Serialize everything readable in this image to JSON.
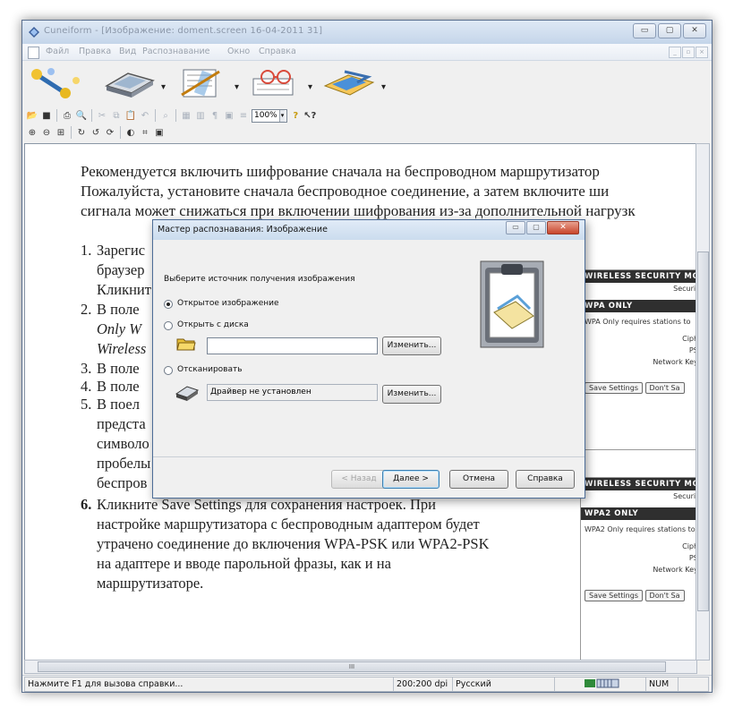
{
  "window": {
    "title": "Cuneiform - [Изображение: doment.screen 16-04-2011 31]",
    "controls": {
      "minimize": "▭",
      "maximize": "▢",
      "close": "✕"
    }
  },
  "menu": {
    "items": [
      "Файл",
      "Правка",
      "Вид",
      "Распознавание",
      "Окно",
      "Справка"
    ],
    "mdi_controls": {
      "minimize": "_",
      "restore": "▫",
      "close": "×"
    }
  },
  "toolbar": {
    "zoom_value": "100%",
    "dropdown_arrow": "▾"
  },
  "document": {
    "paragraph": [
      "Рекомендуется включить шифрование сначала на беспроводном маршрутизатор",
      "Пожалуйста, установите сначала беспроводное соединение, а затем включите ши",
      "сигнала может снижаться при включении шифрования из-за дополнительной нагрузк"
    ],
    "list": [
      {
        "num": "1.",
        "lines": [
          "Зарегис",
          "браузер",
          "Кликнит"
        ]
      },
      {
        "num": "2.",
        "lines": [
          "В поле",
          "Only  W",
          "Wireless"
        ]
      },
      {
        "num": "3.",
        "lines": [
          "В поле"
        ]
      },
      {
        "num": "4.",
        "lines": [
          "В поле"
        ]
      },
      {
        "num": "5.",
        "lines": [
          "В поел",
          "предста",
          "символо",
          "пробелы",
          "беспров"
        ]
      },
      {
        "num": "6.",
        "lines": [
          "Кликните  Save  Settings  для  сохранения  настроек.  При",
          "настройке маршрутизатора с беспроводным адаптером будет",
          "утрачено соединение до включения WPA-PSK или WPA2-PSK",
          "на  адаптере     и  вводе  парольной  фразы,  как  и  на",
          "маршрутизаторе."
        ]
      }
    ],
    "card1": {
      "head1": "WIRELESS SECURITY MO",
      "security": "Security",
      "head2": "WPA ONLY",
      "desc": "WPA Only requires stations to",
      "cipher": "Ciphe",
      "psk": "PSK",
      "netkey": "Network Key :",
      "save": "Save Settings",
      "dont": "Don't Sa"
    },
    "card2": {
      "head1": "WIRELESS SECURITY MO",
      "security": "Security",
      "head2": "WPA2 ONLY",
      "desc": "WPA2 Only requires stations to",
      "cipher": "Ciphe",
      "psk": "PSK",
      "netkey": "Network Key :",
      "save": "Save Settings",
      "dont": "Don't Sa"
    }
  },
  "dialog": {
    "title": "Мастер распознавания: Изображение",
    "prompt": "Выберите источник получения изображения",
    "option_open": "Открытое изображение",
    "option_disk": "Открыть с диска",
    "disk_path": "",
    "change1": "Изменить...",
    "option_scan": "Отсканировать",
    "scanner_value": "Драйвер не установлен",
    "change2": "Изменить...",
    "back": "< Назад",
    "next": "Далее >",
    "cancel": "Отмена",
    "help": "Справка",
    "selected_option": "option_open"
  },
  "scrollbar": {
    "h_grip": "III"
  },
  "status": {
    "help": "Нажмите F1 для вызова справки...",
    "dpi": "200:200 dpi",
    "language": "Русский",
    "num": "NUM"
  }
}
